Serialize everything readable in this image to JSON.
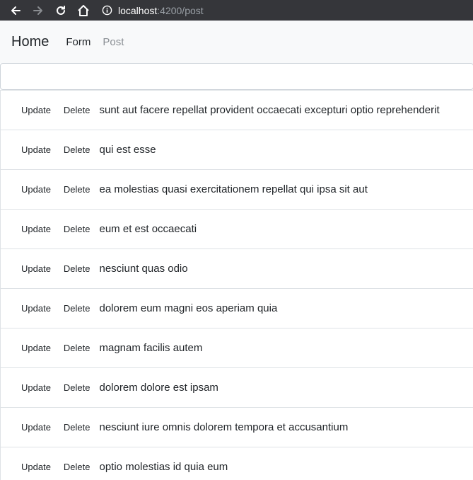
{
  "browser": {
    "url_host": "localhost",
    "url_rest": ":4200/post"
  },
  "navbar": {
    "brand": "Home",
    "links": [
      "Form",
      "Post"
    ]
  },
  "search": {
    "value": "",
    "placeholder": ""
  },
  "posts": {
    "update_label": "Update",
    "delete_label": "Delete",
    "titles": [
      "sunt aut facere repellat provident occaecati excepturi optio reprehenderit",
      "qui est esse",
      "ea molestias quasi exercitationem repellat qui ipsa sit aut",
      "eum et est occaecati",
      "nesciunt quas odio",
      "dolorem eum magni eos aperiam quia",
      "magnam facilis autem",
      "dolorem dolore est ipsam",
      "nesciunt iure omnis dolorem tempora et accusantium",
      "optio molestias id quia eum"
    ]
  }
}
